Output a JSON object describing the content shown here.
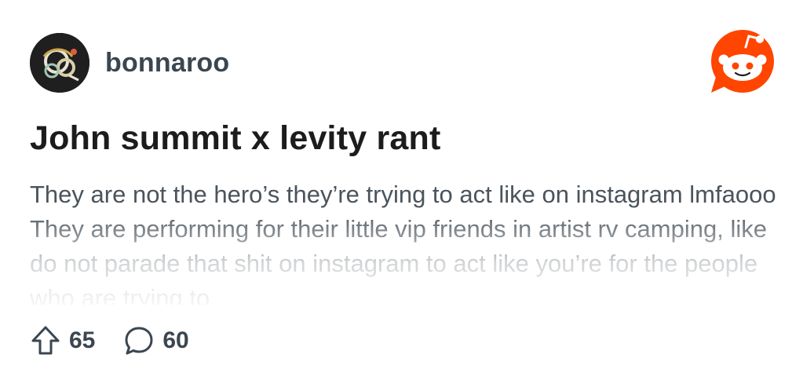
{
  "post": {
    "subreddit": "bonnaroo",
    "title": "John summit x levity rant",
    "body": "They are not the hero’s they’re trying to act like on instagram lmfaooo They are performing for their little vip friends in artist rv camping, like do not parade that shit on instagram to act like you’re for the people who are trying to",
    "upvotes": "65",
    "comments": "60"
  },
  "icons": {
    "avatar": "subreddit-avatar",
    "brand": "reddit-snoo-icon",
    "upvote": "upvote-arrow-icon",
    "comment": "comment-bubble-icon"
  },
  "colors": {
    "reddit_orange": "#ff4500",
    "text_dark": "#1c1c1c",
    "text_muted": "#4b545c"
  }
}
